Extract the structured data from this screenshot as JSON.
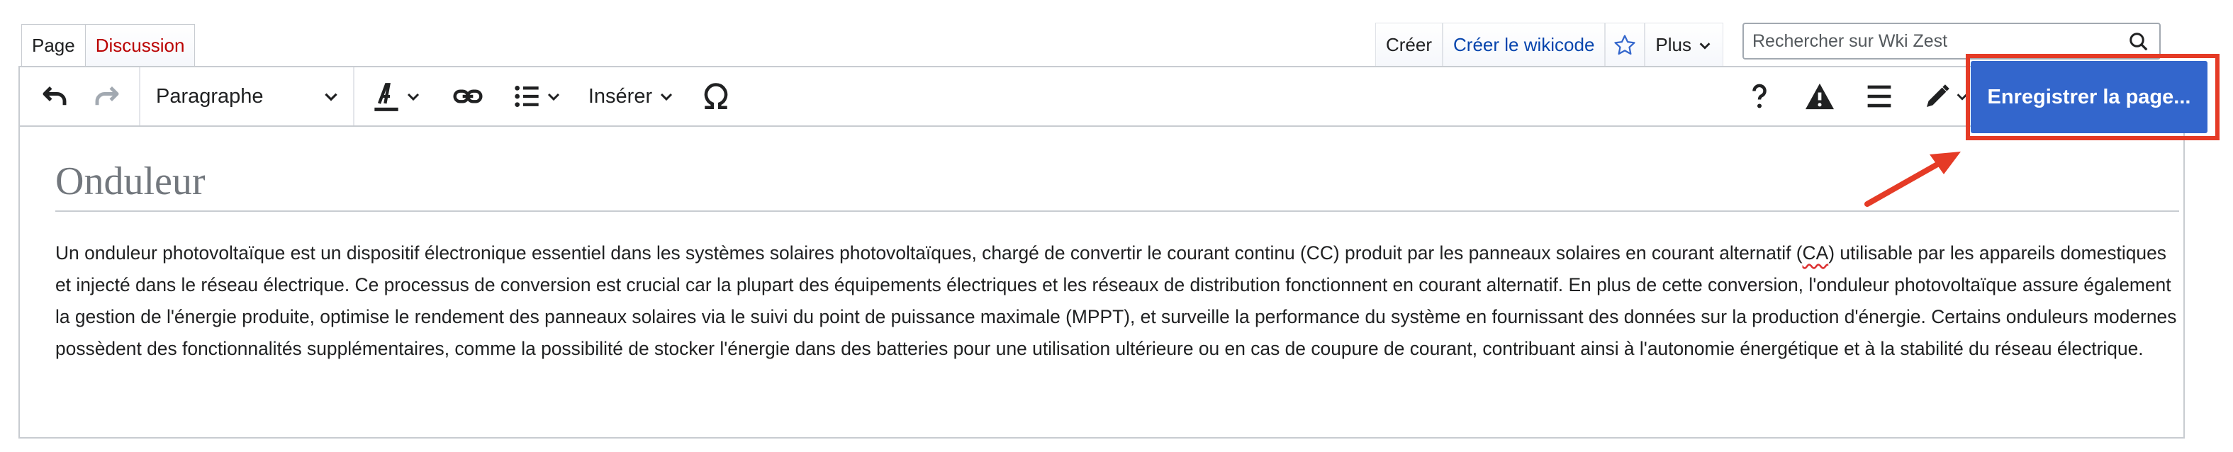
{
  "tabs_left": [
    {
      "label": "Page",
      "active": true
    },
    {
      "label": "Discussion",
      "active": false
    }
  ],
  "tabs_right": {
    "create": "Créer",
    "create_wikicode": "Créer le wikicode",
    "more": "Plus"
  },
  "search": {
    "placeholder": "Rechercher sur Wki Zest"
  },
  "toolbar": {
    "format_label": "Paragraphe",
    "insert_label": "Insérer",
    "save_label": "Enregistrer la page..."
  },
  "article": {
    "title": "Onduleur",
    "body_before_ca": "Un onduleur photovoltaïque est un dispositif électronique essentiel dans les systèmes solaires photovoltaïques, chargé de convertir le courant continu (CC) produit par les panneaux solaires en courant alternatif (",
    "body_ca": "CA",
    "body_after_ca": ") utilisable par les appareils domestiques et injecté dans le réseau électrique. Ce processus de conversion est crucial car la plupart des équipements électriques et les réseaux de distribution fonctionnent en courant alternatif. En plus de cette conversion, l'onduleur photovoltaïque assure également la gestion de l'énergie produite, optimise le rendement des panneaux solaires via le suivi du point de puissance maximale (MPPT), et surveille la performance du système en fournissant des données sur la production d'énergie. Certains onduleurs modernes possèdent des fonctionnalités supplémentaires, comme la possibilité de stocker l'énergie dans des batteries pour une utilisation ultérieure ou en cas de coupure de courant, contribuant ainsi à l'autonomie énergétique et à la stabilité du réseau électrique."
  },
  "icons": [
    "undo-icon",
    "redo-icon",
    "text-style-icon",
    "link-icon",
    "list-icon",
    "special-character-icon",
    "help-icon",
    "warning-icon",
    "menu-icon",
    "pencil-icon",
    "star-icon",
    "search-icon",
    "chevron-down-icon"
  ],
  "colors": {
    "accent": "#3366cc",
    "highlight": "#e53b26",
    "link": "#0645ad",
    "redlink": "#ba0000"
  }
}
